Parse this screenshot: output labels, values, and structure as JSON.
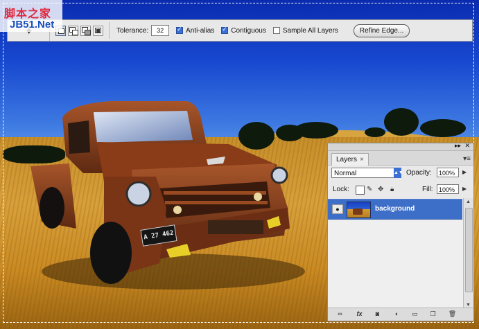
{
  "watermark": {
    "chinese": "脚本之家",
    "site": "JB51.Net"
  },
  "options_bar": {
    "tolerance_label": "Tolerance:",
    "tolerance_value": "32",
    "anti_alias_label": "Anti-alias",
    "anti_alias_checked": true,
    "contiguous_label": "Contiguous",
    "contiguous_checked": true,
    "sample_all_layers_label": "Sample All Layers",
    "sample_all_layers_checked": false,
    "refine_edge_label": "Refine Edge..."
  },
  "layers_panel": {
    "tab_label": "Layers",
    "tab_close": "×",
    "blend_mode": "Normal",
    "opacity_label": "Opacity:",
    "opacity_value": "100%",
    "lock_label": "Lock:",
    "fill_label": "Fill:",
    "fill_value": "100%",
    "layers": [
      {
        "name": "background",
        "visible": true,
        "selected": true
      }
    ]
  },
  "license_plate": "A 27 462",
  "colors": {
    "selection": "#3d6ec8",
    "sky": "#1849d0",
    "field": "#d8a03a"
  }
}
